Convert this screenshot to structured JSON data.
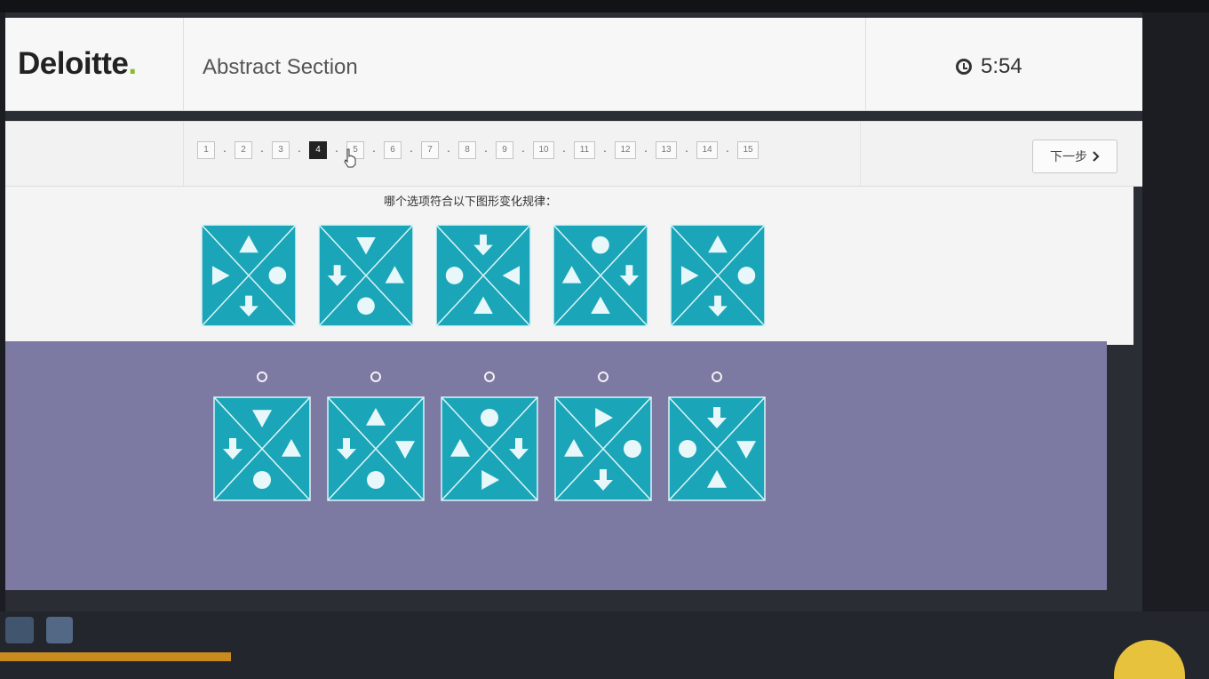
{
  "header": {
    "logo_text": "Deloitte",
    "logo_dot": ".",
    "section_title": "Abstract Section",
    "timer": "5:54"
  },
  "pager": {
    "pages": [
      "1",
      "2",
      "3",
      "4",
      "5",
      "6",
      "7",
      "8",
      "9",
      "10",
      "11",
      "12",
      "13",
      "14",
      "15"
    ],
    "current": "4",
    "separator": "·"
  },
  "next_button": {
    "label": "下一步",
    "icon": "chevron-right-icon"
  },
  "question": {
    "text": "哪个选项符合以下图形变化规律："
  },
  "figures": {
    "colors": {
      "tile": "#1aa6b8",
      "line": "#dff4f7",
      "shape": "#e8f8fa"
    },
    "sequence": [
      {
        "top": "triangle-up",
        "left": "triangle-right",
        "right": "circle",
        "bottom": "arrow-down"
      },
      {
        "top": "triangle-down",
        "left": "arrow-down",
        "right": "triangle-up",
        "bottom": "circle"
      },
      {
        "top": "arrow-down",
        "left": "circle",
        "right": "triangle-left",
        "bottom": "triangle-up"
      },
      {
        "top": "circle",
        "left": "triangle-up",
        "right": "arrow-down",
        "bottom": "triangle-up"
      },
      {
        "top": "triangle-up",
        "left": "triangle-right",
        "right": "circle",
        "bottom": "arrow-down"
      }
    ],
    "options": [
      {
        "top": "triangle-down",
        "left": "arrow-down",
        "right": "triangle-up",
        "bottom": "circle"
      },
      {
        "top": "triangle-up",
        "left": "arrow-down",
        "right": "triangle-down",
        "bottom": "circle"
      },
      {
        "top": "circle",
        "left": "triangle-up",
        "right": "arrow-down",
        "bottom": "triangle-right"
      },
      {
        "top": "triangle-right",
        "left": "triangle-up",
        "right": "circle",
        "bottom": "arrow-down"
      },
      {
        "top": "arrow-down",
        "left": "circle",
        "right": "triangle-down",
        "bottom": "triangle-up"
      }
    ]
  }
}
